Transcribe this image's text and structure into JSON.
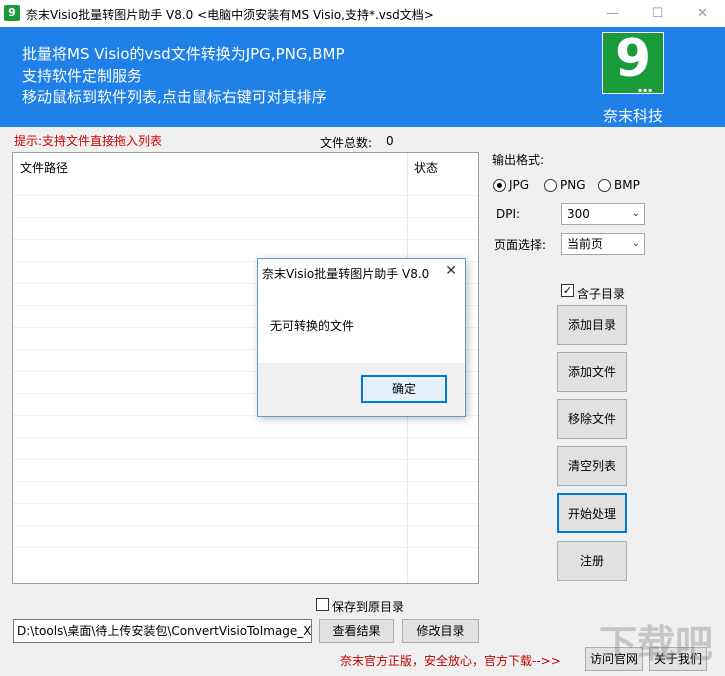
{
  "window": {
    "title": "奈末Visio批量转图片助手  V8.0  <电脑中须安装有MS Visio,支持*.vsd文档>",
    "minimize": "—",
    "maximize": "☐",
    "close": "✕"
  },
  "banner": {
    "lines": [
      "批量将MS Visio的vsd文件转换为JPG,PNG,BMP",
      "支持软件定制服务",
      "移动鼠标到软件列表,点击鼠标右键可对其排序"
    ],
    "logo_digit": "9",
    "logo_dots": "...",
    "logo_caption": "奈末科技"
  },
  "list": {
    "tip": "提示:支持文件直接拖入列表",
    "count_label": "文件总数:",
    "count_value": "0",
    "columns": [
      "文件路径",
      "状态"
    ]
  },
  "options": {
    "format_label": "输出格式:",
    "formats": [
      {
        "label": "JPG",
        "selected": true
      },
      {
        "label": "PNG",
        "selected": false
      },
      {
        "label": "BMP",
        "selected": false
      }
    ],
    "dpi_label": "DPI:",
    "dpi_value": "300",
    "page_label": "页面选择:",
    "page_value": "当前页",
    "subdir_label": "含子目录",
    "subdir_checked": true
  },
  "buttons": {
    "add_dir": "添加目录",
    "add_file": "添加文件",
    "remove_file": "移除文件",
    "clear_list": "清空列表",
    "start": "开始处理",
    "register": "注册"
  },
  "bottom": {
    "save_original_label": "保存到原目录",
    "save_original_checked": false,
    "output_path": "D:\\tools\\桌面\\待上传安装包\\ConvertVisioToImage_Xia",
    "view_result": "查看结果",
    "change_dir": "修改目录",
    "promo": "奈末官方正版，安全放心，官方下载-->>",
    "visit_site": "访问官网",
    "about": "关于我们"
  },
  "dialog": {
    "title": "奈末Visio批量转图片助手 V8.0",
    "close": "✕",
    "message": "无可转换的文件",
    "ok": "确定"
  },
  "watermark": "下载吧",
  "colors": {
    "banner": "#1f80e8",
    "logo_green": "#1a9b3a",
    "tip_red": "#d00000",
    "focus_blue": "#0078d7"
  }
}
